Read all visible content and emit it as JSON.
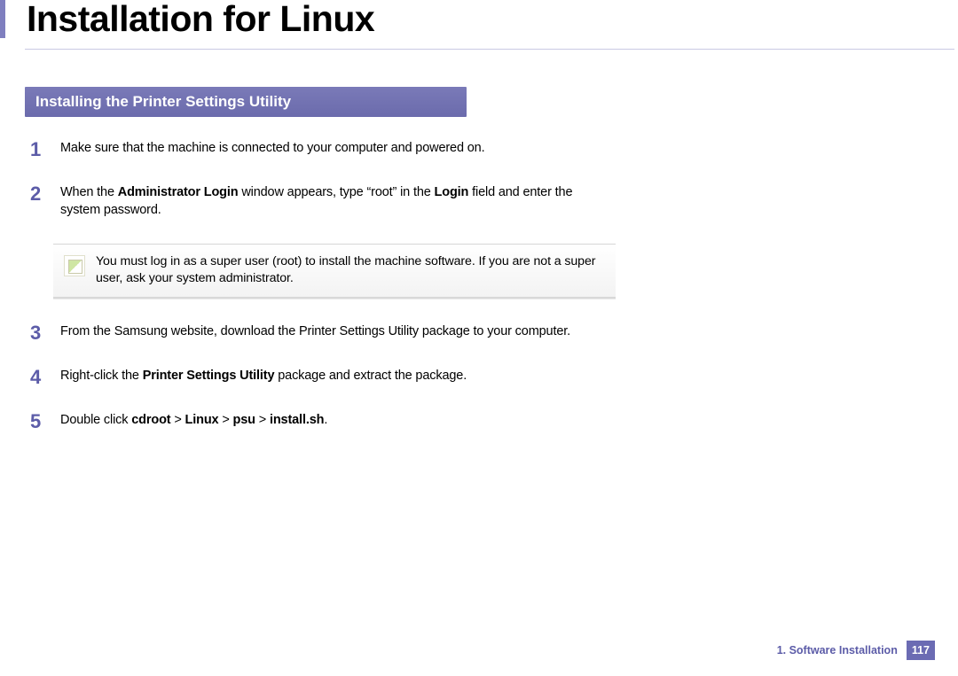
{
  "title": "Installation for Linux",
  "section_heading": "Installing the Printer Settings Utility",
  "steps": [
    {
      "num": "1",
      "parts": [
        {
          "t": "Make sure that the machine is connected to your computer and powered on."
        }
      ]
    },
    {
      "num": "2",
      "parts": [
        {
          "t": "When the "
        },
        {
          "t": "Administrator Login",
          "b": true
        },
        {
          "t": " window appears, type “root” in the "
        },
        {
          "t": "Login",
          "b": true
        },
        {
          "t": " field and enter the system password."
        }
      ]
    },
    {
      "num": "3",
      "parts": [
        {
          "t": "From the Samsung website, download the Printer Settings Utility package to your computer."
        }
      ]
    },
    {
      "num": "4",
      "parts": [
        {
          "t": "Right-click the "
        },
        {
          "t": "Printer Settings Utility",
          "b": true
        },
        {
          "t": " package and extract the package."
        }
      ]
    },
    {
      "num": "5",
      "parts": [
        {
          "t": "Double click "
        },
        {
          "t": "cdroot",
          "b": true
        },
        {
          "t": " > "
        },
        {
          "t": "Linux",
          "b": true
        },
        {
          "t": " > "
        },
        {
          "t": "psu",
          "b": true
        },
        {
          "t": " > "
        },
        {
          "t": "install.sh",
          "b": true
        },
        {
          "t": "."
        }
      ]
    }
  ],
  "note": "You must log in as a super user (root) to install the machine software. If you are not a super user, ask your system administrator.",
  "footer": {
    "chapter": "1.  Software Installation",
    "page": "117"
  }
}
